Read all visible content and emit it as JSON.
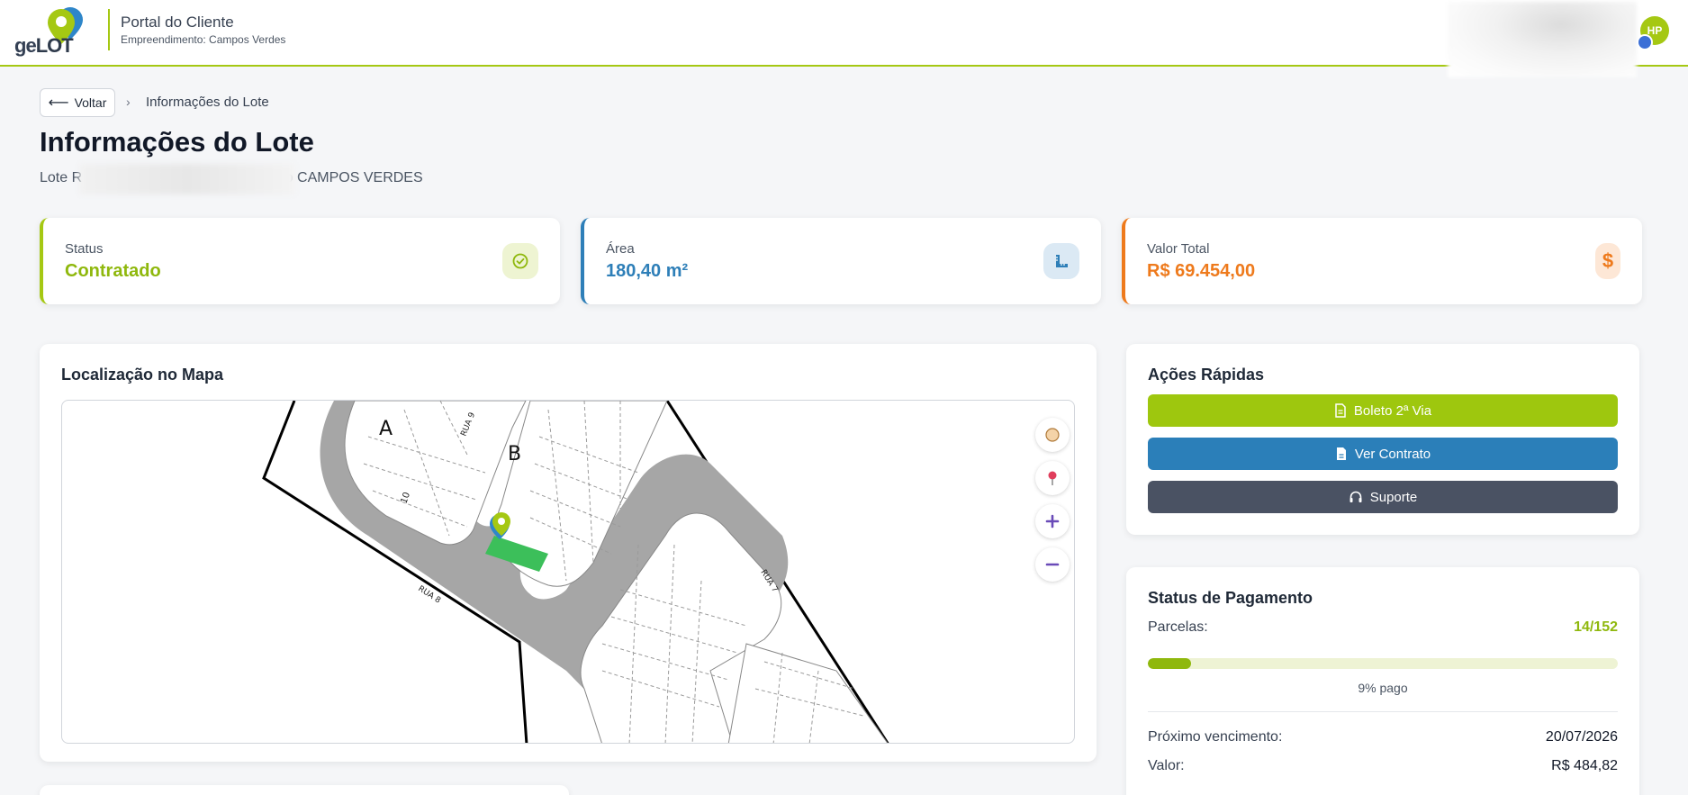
{
  "header": {
    "logo_text_ge": "ge",
    "logo_text_lot": "LOT",
    "portal_title": "Portal do Cliente",
    "portal_subtitle": "Empreendimento: Campos Verdes",
    "avatar_initials": "HP"
  },
  "breadcrumb": {
    "back_label": "Voltar",
    "current": "Informações do Lote"
  },
  "page": {
    "title": "Informações do Lote",
    "subtitle_start": "Lote R",
    "subtitle_end": "mento CAMPOS VERDES"
  },
  "stats": [
    {
      "label": "Status",
      "value": "Contratado",
      "color": "#8fb80d",
      "icon": "check-circle-icon"
    },
    {
      "label": "Área",
      "value": "180,40 m²",
      "color": "#2e7fb8",
      "icon": "ruler-icon"
    },
    {
      "label": "Valor Total",
      "value": "R$ 69.454,00",
      "color": "#ee7a1c",
      "icon": "dollar-icon"
    }
  ],
  "map": {
    "title": "Localização no Mapa",
    "quadra_a": "A",
    "quadra_b": "B",
    "street_rua8": "RUA 8",
    "street_rua9": "RUA 9",
    "street_rua7": "RUA 7",
    "lot_number": "10"
  },
  "quick_actions": {
    "title": "Ações Rápidas",
    "boleto_label": "Boleto 2ª Via",
    "contrato_label": "Ver Contrato",
    "suporte_label": "Suporte",
    "boleto_color": "#9ec70e",
    "contrato_color": "#2b7fb9",
    "suporte_color": "#4a5263"
  },
  "payment": {
    "title": "Status de Pagamento",
    "parcelas_label": "Parcelas:",
    "parcelas_value": "14/152",
    "progress_fraction": 0.092,
    "progress_text": "9% pago",
    "next_due_label": "Próximo vencimento:",
    "next_due_value": "20/07/2026",
    "valor_label": "Valor:",
    "valor_value": "R$ 484,82"
  }
}
